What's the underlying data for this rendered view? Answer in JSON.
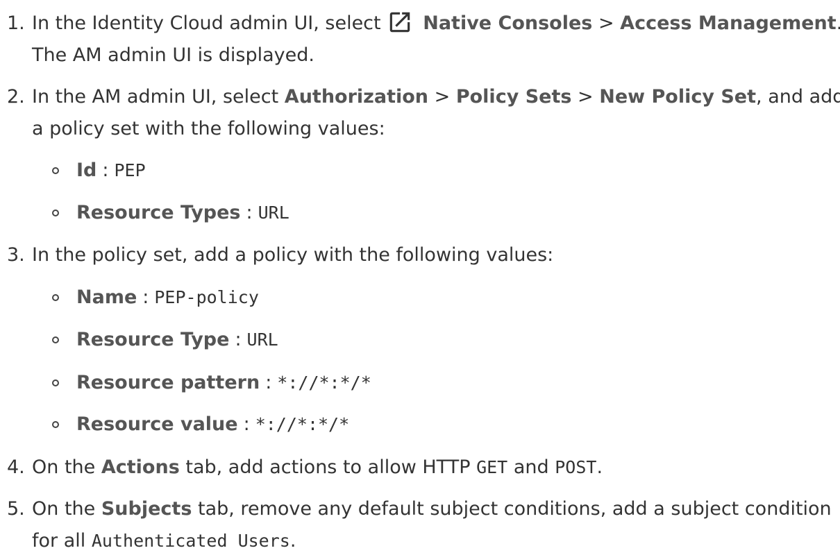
{
  "steps": [
    {
      "number": "1.",
      "line1_pre": "In the Identity Cloud admin UI, select",
      "icon": "external-link-icon",
      "nav1": "Native Consoles",
      "sep": ">",
      "nav2": "Access Management",
      "end": ".",
      "line2": "The AM admin UI is displayed."
    },
    {
      "number": "2.",
      "line1_pre": "In the AM admin UI, select",
      "nav1": "Authorization",
      "sep": ">",
      "nav2": "Policy Sets",
      "nav3": "New Policy Set",
      "line1_post": ", and add",
      "line2": "a policy set with the following values:",
      "items": [
        {
          "label": "Id",
          "value": "PEP"
        },
        {
          "label": "Resource Types",
          "value": "URL"
        }
      ]
    },
    {
      "number": "3.",
      "text": "In the policy set, add a policy with the following values:",
      "items": [
        {
          "label": "Name",
          "value": "PEP-policy"
        },
        {
          "label": "Resource Type",
          "value": "URL"
        },
        {
          "label": "Resource pattern",
          "value": "*://*:*/*"
        },
        {
          "label": "Resource value",
          "value": "*://*:*/*"
        }
      ]
    },
    {
      "number": "4.",
      "pre": "On the",
      "tab": "Actions",
      "mid": "tab, add actions to allow HTTP",
      "code1": "GET",
      "and": "and",
      "code2": "POST",
      "end": "."
    },
    {
      "number": "5.",
      "pre": "On the",
      "tab": "Subjects",
      "mid": "tab, remove any default subject conditions, add a subject condition",
      "line2_pre": "for all",
      "code": "Authenticated Users",
      "end": "."
    }
  ],
  "colon": ":"
}
